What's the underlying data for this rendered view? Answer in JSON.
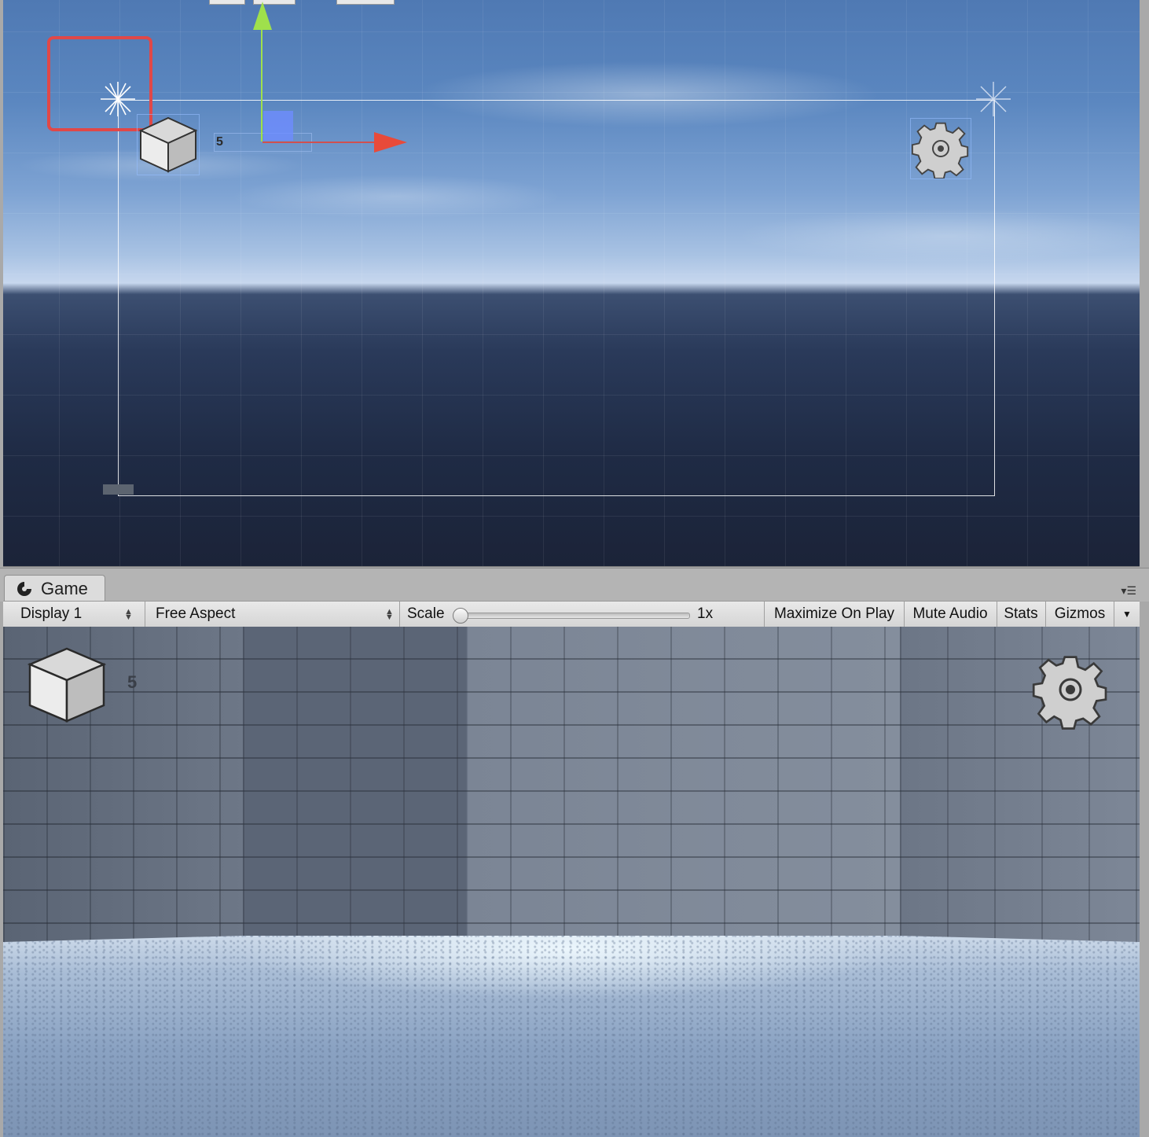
{
  "scene_view": {
    "label_value": "5",
    "icons": [
      "light-icon",
      "cube-icon",
      "gear-icon",
      "move-y-arrow-icon",
      "move-x-arrow-icon"
    ]
  },
  "game_panel": {
    "tab_label": "Game",
    "panel_menu_icon": "dropdown-list-icon",
    "toolbar": {
      "display": "Display 1",
      "aspect": "Free Aspect",
      "scale_label": "Scale",
      "scale_value": "1x",
      "scale_slider_fraction": 0.0,
      "maximize": "Maximize On Play",
      "mute": "Mute Audio",
      "stats": "Stats",
      "gizmos": "Gizmos"
    },
    "hud": {
      "count": "5",
      "left_icon": "cube-icon",
      "right_icon": "gear-icon"
    }
  },
  "colors": {
    "highlight": "#e04848",
    "x_axis": "#e84a3a",
    "y_axis": "#9fe04c"
  }
}
